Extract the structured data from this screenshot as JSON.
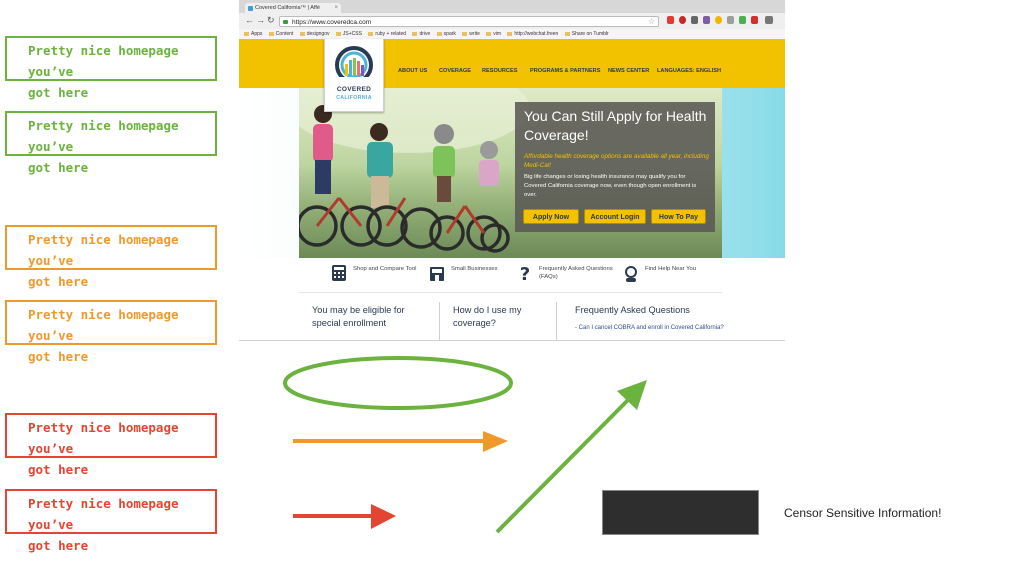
{
  "callout_text": "Pretty nice homepage you've got here",
  "callout_line1": "Pretty nice homepage you’ve",
  "callout_line2": "got here",
  "colors": {
    "green": "#6bb23f",
    "orange": "#f0992b",
    "red": "#e44532",
    "site_yellow": "#f2c100",
    "site_navy": "#283a54",
    "censor": "#2e2e2e"
  },
  "browser": {
    "tab_title": "Covered California™ | Affé",
    "url": "https://www.coveredca.com",
    "bookmarks": [
      "Apps",
      "Content",
      "designgov",
      "JS+CSS",
      "ruby + related",
      "drive",
      "spark",
      "write",
      "vim",
      "http://webchat.freen",
      "Share on Tumblr"
    ]
  },
  "site": {
    "logo_line1": "COVERED",
    "logo_line2": "CALIFORNIA",
    "nav": [
      "ABOUT US",
      "COVERAGE",
      "RESOURCES",
      "PROGRAMS & PARTNERS",
      "NEWS CENTER",
      "LANGUAGES: ENGLISH"
    ],
    "hero_heading": "You Can Still Apply for Health Coverage!",
    "hero_subheading": "Affordable health coverage options are available all year, including Medi-Cal!",
    "hero_body": "Big life changes or losing health insurance may qualify you for Covered California coverage now, even though open enrollment is over.",
    "buttons": [
      "Apply Now",
      "Account Login",
      "How To Pay"
    ],
    "quick_links": [
      "Shop and Compare Tool",
      "Small Businesses",
      "Frequently Asked Questions (FAQs)",
      "Find Help Near You"
    ],
    "sections": [
      "You may be eligible for special enrollment",
      "How do I use my coverage?",
      "Frequently Asked Questions"
    ],
    "faq_link": "- Can I cancel COBRA and enroll in Covered California?"
  },
  "caption": "Censor Sensitive Information!"
}
